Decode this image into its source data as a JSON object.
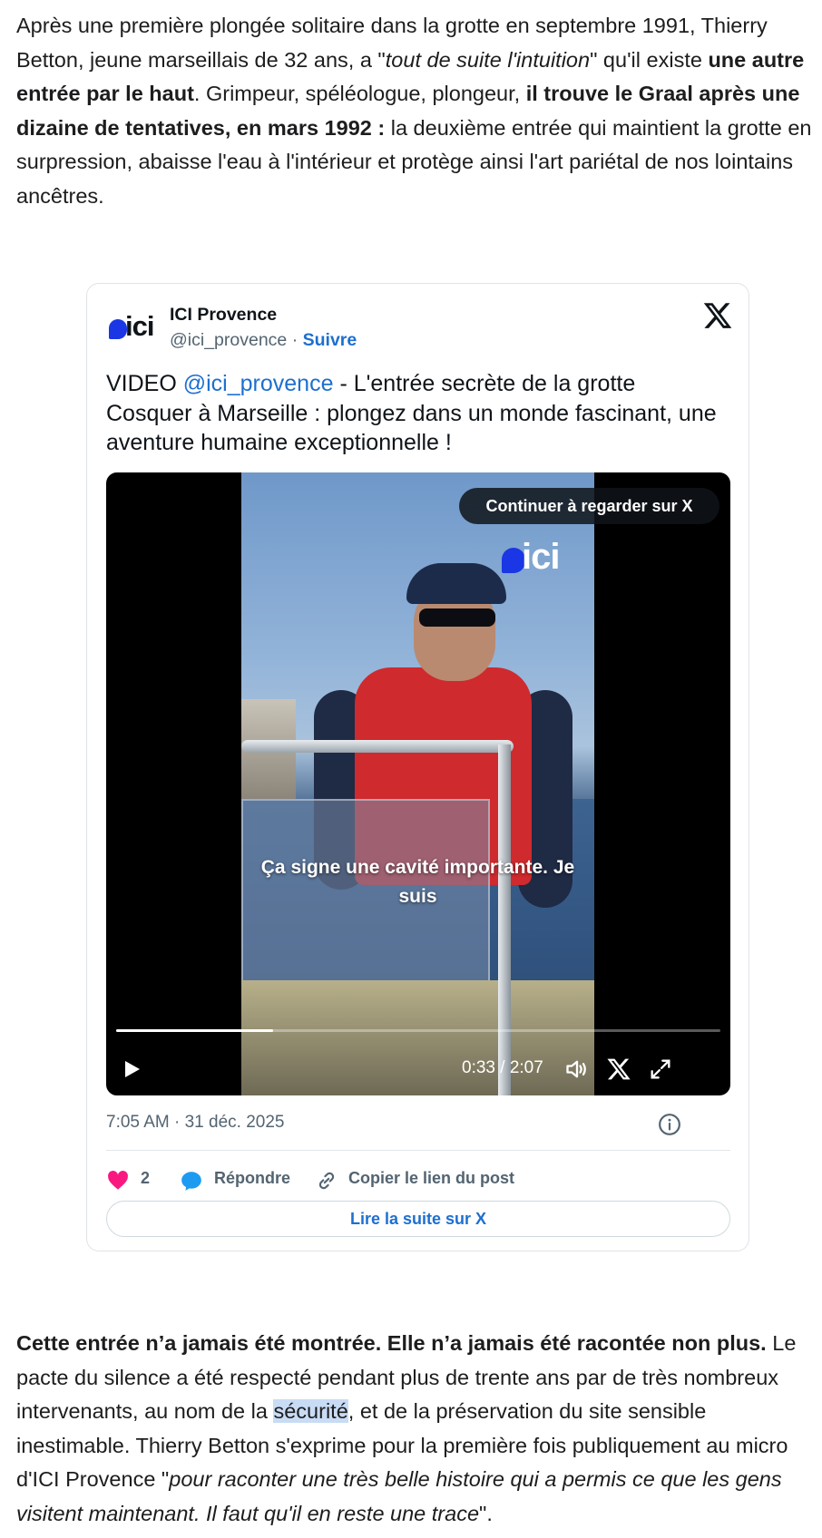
{
  "intro": {
    "t1": "Après une première plongée solitaire dans la grotte en septembre 1991, Thierry Betton, jeune marseillais de 32 ans, a \"",
    "t2": "tout de suite l'intuition",
    "t3": "\" qu'il existe ",
    "t4": "une autre entrée par le haut",
    "t5": ". Grimpeur, spéléologue, plongeur, ",
    "t6": "il trouve le Graal après une dizaine de tentatives, en mars 1992 :",
    "t7": " la deuxième entrée qui maintient la grotte en surpression, abaisse l'eau à l'intérieur et protège ainsi l'art pariétal de nos lointains ancêtres."
  },
  "tweet": {
    "logo_text": "ici",
    "account_name": "ICI Provence",
    "handle": "@ici_provence",
    "separator": " · ",
    "follow_label": "Suivre",
    "text_prefix": "VIDEO ",
    "text_mention": "@ici_provence",
    "text_body": " - L'entrée secrète de la grotte Cosquer à Marseille : plongez dans un monde fascinant, une aventure humaine exceptionnelle !",
    "video": {
      "watermark": "ici",
      "continue_label": "Continuer à regarder sur X",
      "caption": "Ça signe une cavité importante. Je suis",
      "time": "0:33 / 2:07",
      "progress": 0.26
    },
    "date": "7:05 AM · 31 déc. 2025",
    "likes": "2",
    "reply_label": "Répondre",
    "copy_label": "Copier le lien du post",
    "read_more_label": "Lire la suite sur X",
    "colors": {
      "link": "#1d6fd0",
      "heart": "#f91880",
      "ici_blue": "#1b36e4"
    }
  },
  "outro": {
    "t1": "Cette entrée n’a jamais été montrée. Elle n’a jamais été racontée non plus.",
    "t2": " Le pacte du silence a été respecté pendant plus de trente ans par de très nombreux intervenants, au nom de la ",
    "t3": "sécurité",
    "t4": ", et de la préservation du site sensible inestimable. Thierry Betton s'exprime pour la première fois publiquement au micro d'ICI Provence \"",
    "t5": "pour raconter une très belle histoire qui a permis ce que les gens visitent maintenant. Il faut qu'il en reste une trace",
    "t6": "\"."
  }
}
